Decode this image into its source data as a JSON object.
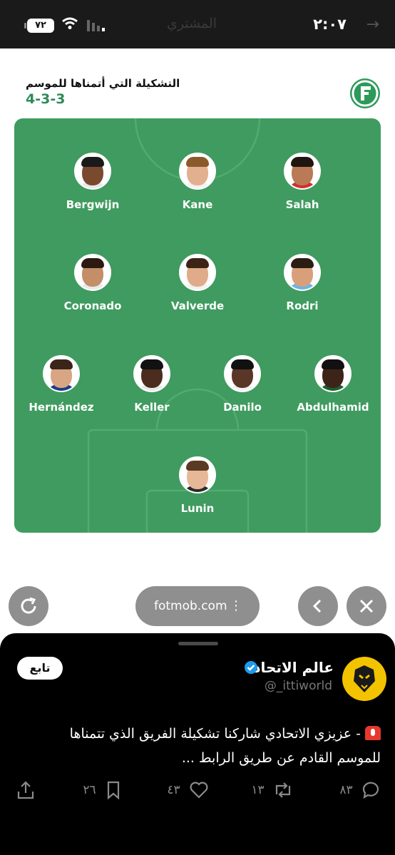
{
  "status_bar": {
    "time": "٢:٠٧",
    "center_text": "المشتري",
    "battery": "٧٢"
  },
  "lineup": {
    "title": "التشكيلة التي أتمناها للموسم",
    "formation": "4-3-3",
    "players": [
      {
        "name": "Bergwijn",
        "skin": "#7a4a2e",
        "hair": "#1a1a1a",
        "shirt": "#e9e9e9"
      },
      {
        "name": "Kane",
        "skin": "#e2b08f",
        "hair": "#8b5a2b",
        "shirt": "#f2f2f2"
      },
      {
        "name": "Salah",
        "skin": "#b97a55",
        "hair": "#1f1511",
        "shirt": "#d32f2f"
      },
      {
        "name": "Coronado",
        "skin": "#c48e68",
        "hair": "#2a1a12",
        "shirt": "#e9e9e9"
      },
      {
        "name": "Valverde",
        "skin": "#e0ab88",
        "hair": "#3b2416",
        "shirt": "#f2f2f2"
      },
      {
        "name": "Rodri",
        "skin": "#d8a07a",
        "hair": "#2c1d14",
        "shirt": "#6cb4e4"
      },
      {
        "name": "Hernández",
        "skin": "#d9a683",
        "hair": "#3a2518",
        "shirt": "#1d3d8a"
      },
      {
        "name": "Keller",
        "skin": "#4a2d1e",
        "hair": "#111111",
        "shirt": "#e9e9e9"
      },
      {
        "name": "Danilo",
        "skin": "#5a3626",
        "hair": "#111111",
        "shirt": "#f2f2f2"
      },
      {
        "name": "Abdulhamid",
        "skin": "#3d2419",
        "hair": "#111111",
        "shirt": "#1d5e2e"
      },
      {
        "name": "Lunin",
        "skin": "#e6b897",
        "hair": "#5a3a22",
        "shirt": "#2b2b2b"
      }
    ]
  },
  "browser": {
    "url": "fotmob.com",
    "reload_icon": "reload-icon",
    "back_icon": "chevron-left-icon",
    "close_icon": "close-icon",
    "more_icon": "more-vertical-icon"
  },
  "tweet": {
    "author_name": "عالم الاتحاد",
    "handle": "@_ittiworld",
    "follow_label": "تابع",
    "text_line1": "- عزيزي الاتحادي شاركنا تشكيلة الفريق الذي تتمناها",
    "text_line2": "للموسم القادم عن طريق الرابط ...",
    "replies": "٨٣",
    "retweets": "١٣",
    "likes": "٤٣",
    "bookmarks": "٢٦"
  },
  "colors": {
    "pitch": "#3f9b5f",
    "accent": "#2e8b57",
    "avatar_bg": "#f4c300"
  }
}
